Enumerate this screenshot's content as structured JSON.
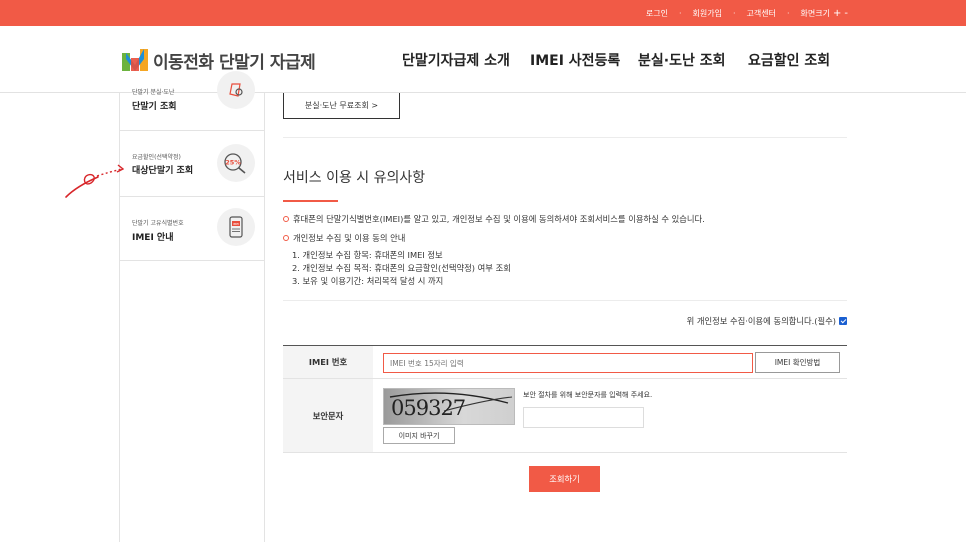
{
  "topbar": {
    "links": [
      "로그인",
      "회원가입",
      "고객센터"
    ],
    "font_size_label": "화면크기",
    "font_plus": "+",
    "font_minus": "-",
    "separator": "·"
  },
  "header": {
    "logo_text": "이동전화 단말기 자급제",
    "nav": [
      "단말기자급제 소개",
      "IMEI 사전등록",
      "분실·도난 조회",
      "요금할인 조회"
    ]
  },
  "sidebar": {
    "items": [
      {
        "sub": "단말기 분실·도난",
        "main": "단말기 조회",
        "icon": "phone-search-icon"
      },
      {
        "sub": "요금할인(선택약정)",
        "main": "대상단말기 조회",
        "icon": "discount-search-icon",
        "badge": "25%"
      },
      {
        "sub": "단말기 고유식별번호",
        "main": "IMEI 안내",
        "icon": "imei-phone-icon",
        "badge": "IMEI"
      }
    ]
  },
  "main": {
    "free_button": "분실·도난 무료조회 >",
    "section_title": "서비스 이용 시 유의사항",
    "bullets": [
      "휴대폰의 단말기식별번호(IMEI)를 알고 있고, 개인정보 수집 및 이용에 동의하셔야 조회서비스를 이용하실 수 있습니다.",
      "개인정보 수집 및 이용 동의 안내"
    ],
    "numbered": [
      "1. 개인정보 수집 항목: 휴대폰의 IMEI 정보",
      "2. 개인정보 수집 목적: 휴대폰의 요금할인(선택약정) 여부 조회",
      "3. 보유 및 이용기간: 처리목적 달성 시 까지"
    ],
    "agree_label": "위 개인정보 수집·이용에 동의합니다.(필수)",
    "agree_checked": true,
    "form": {
      "imei_label": "IMEI 번호",
      "imei_placeholder": "IMEI 번호 15자리 입력",
      "imei_help_button": "IMEI 확인방법",
      "captcha_label": "보안문자",
      "captcha_value": "059327",
      "captcha_hint": "보안 절차를 위해 보안문자를 입력해 주세요.",
      "change_image_button": "이미지 바꾸기",
      "submit_button": "조회하기"
    }
  },
  "colors": {
    "accent": "#f15a46",
    "checkbox": "#1a5fd1"
  }
}
